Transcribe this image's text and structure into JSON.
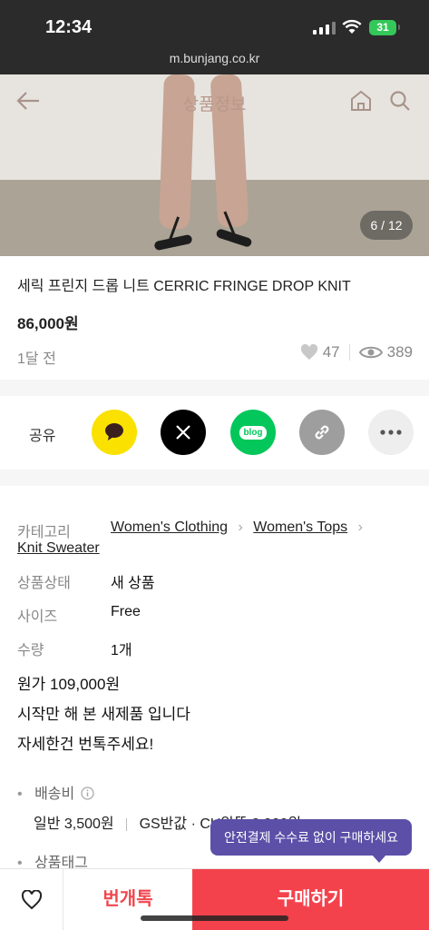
{
  "status": {
    "time": "12:34",
    "battery": "31"
  },
  "browser": {
    "url": "m.bunjang.co.kr"
  },
  "header": {
    "title": "상품정보",
    "photo_counter": "6 / 12"
  },
  "product": {
    "title": "세릭 프린지 드롭 니트 CERRIC FRINGE DROP KNIT",
    "price": "86,000원",
    "time_ago": "1달 전",
    "likes": "47",
    "views": "389"
  },
  "share": {
    "label": "공유",
    "items": [
      "kakaotalk",
      "x",
      "blog",
      "link",
      "more"
    ],
    "blog_text": "blog"
  },
  "details": {
    "category_label": "카테고리",
    "categories": [
      "Women's Clothing",
      "Women's Tops",
      "Knit Sweater"
    ],
    "condition_label": "상품상태",
    "condition": "새 상품",
    "size_label": "사이즈",
    "size": "Free",
    "quantity_label": "수량",
    "quantity": "1개"
  },
  "description": [
    "원가 109,000원",
    "시작만 해 본 새제품 입니다",
    "자세한건 번톡주세요!"
  ],
  "shipping": {
    "label": "배송비",
    "normal": "일반 3,500원",
    "gs": "GS반값 · CU알뜰 2,000원"
  },
  "tags": {
    "label": "상품태그"
  },
  "tooltip": "안전결제 수수료 없이 구매하세요",
  "actions": {
    "chat": "번개톡",
    "buy": "구매하기"
  },
  "colors": {
    "accent": "#f4424c",
    "tooltip": "#5b4fa8",
    "kakao": "#fae100",
    "blog": "#03c75a"
  }
}
